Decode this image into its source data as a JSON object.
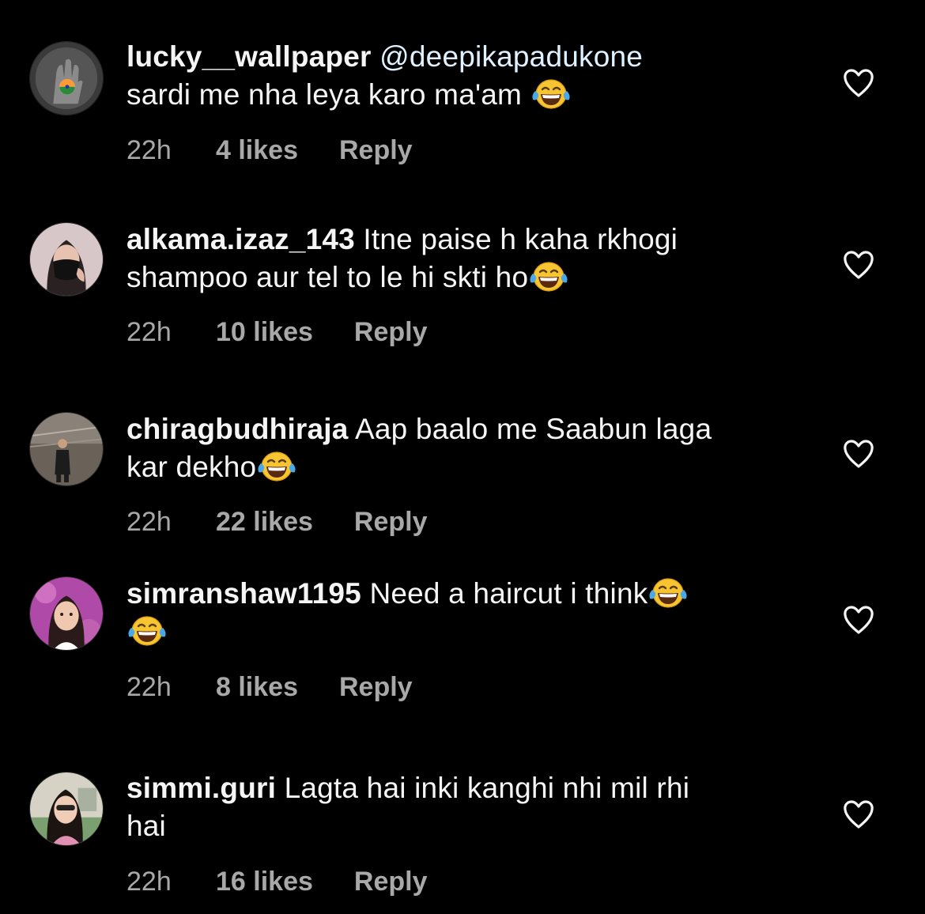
{
  "comments": [
    {
      "username": "lucky__wallpaper",
      "mention": "@deepikapadukone",
      "text": "sardi me nha leya karo ma'am",
      "time": "22h",
      "likes": "4 likes",
      "reply": "Reply"
    },
    {
      "username": "alkama.izaz_143",
      "text_line1": "Itne paise h kaha rkhogi",
      "text_line2": "shampoo aur tel to le hi skti ho",
      "time": "22h",
      "likes": "10 likes",
      "reply": "Reply"
    },
    {
      "username": "chiragbudhiraja",
      "text_line1": "Aap baalo me Saabun laga",
      "text_line2": "kar dekho",
      "time": "22h",
      "likes": "22 likes",
      "reply": "Reply"
    },
    {
      "username": "simranshaw1195",
      "text": "Need a haircut i think",
      "time": "22h",
      "likes": "8 likes",
      "reply": "Reply"
    },
    {
      "username": "simmi.guri",
      "text_line1": "Lagta hai inki kanghi nhi mil rhi",
      "text_line2": "hai",
      "time": "22h",
      "likes": "16 likes",
      "reply": "Reply"
    }
  ],
  "icons": {
    "like": "heart-outline-icon",
    "emoji": "face-with-tears-of-joy-emoji"
  },
  "colors": {
    "background": "#000000",
    "text": "#f5f5f5",
    "meta_text": "#a8a8a8",
    "mention": "#e0f1ff"
  }
}
